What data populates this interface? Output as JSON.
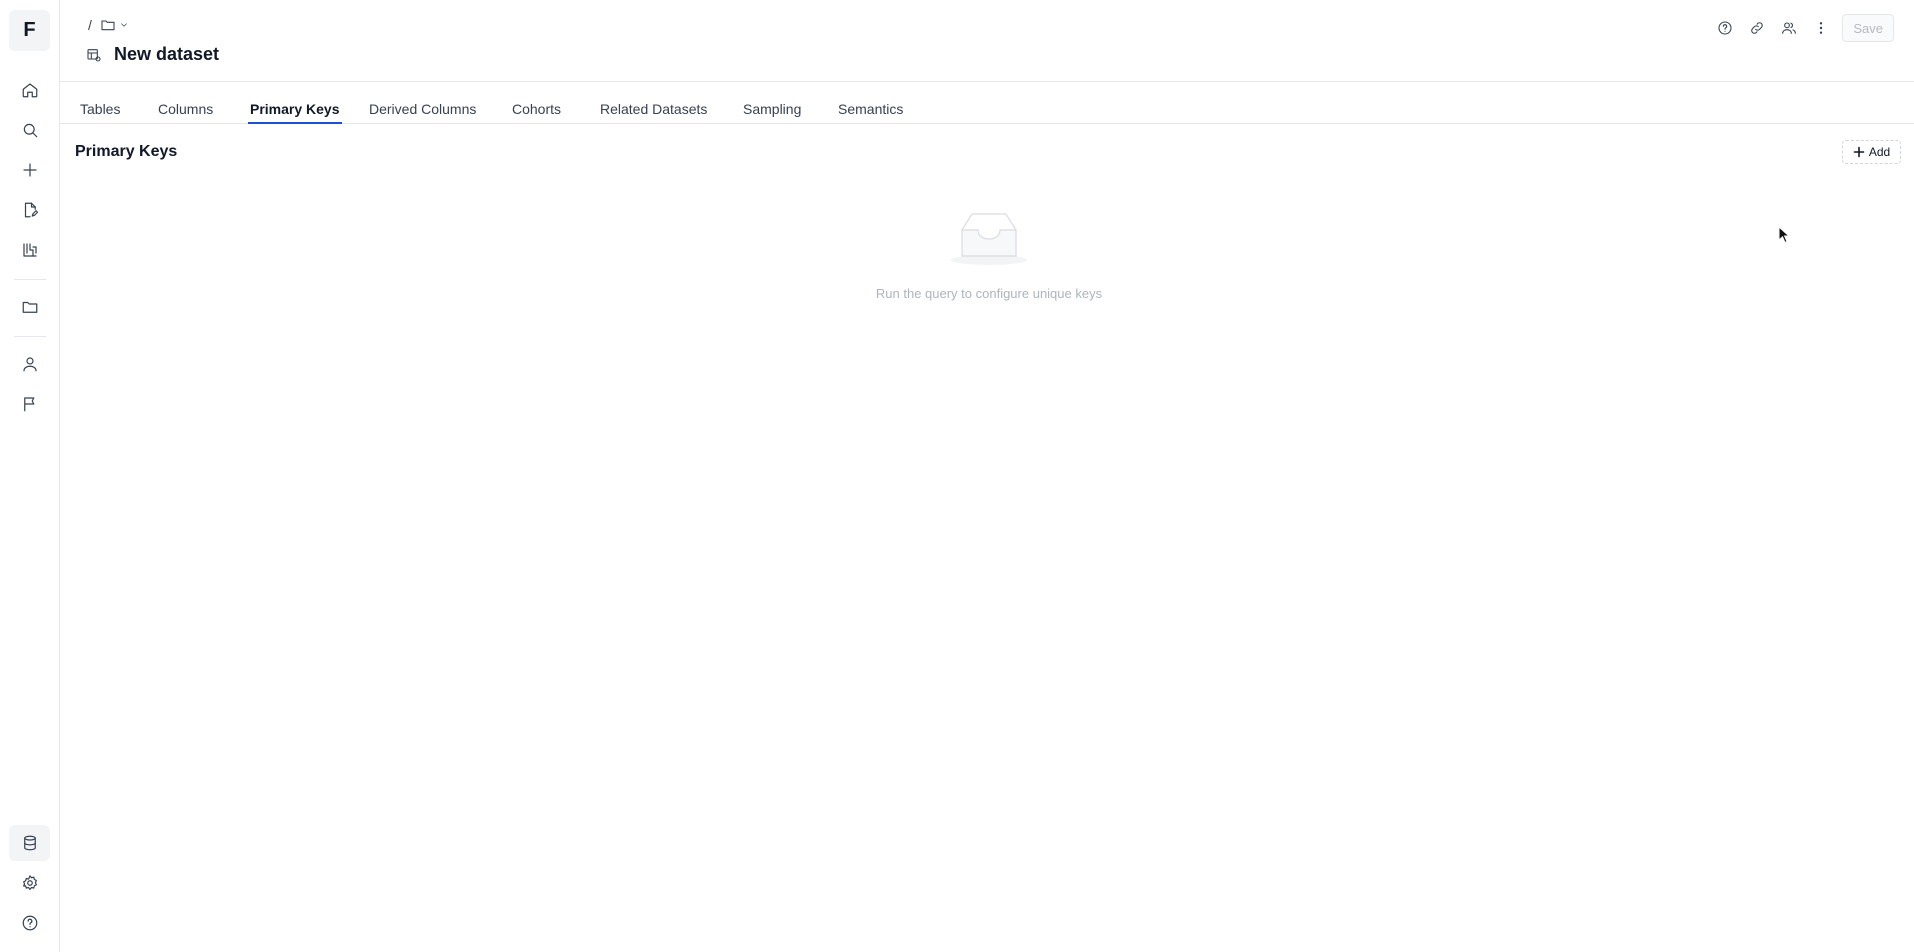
{
  "app": {
    "logo_letter": "F"
  },
  "sidebar": {
    "items": [
      {
        "name": "home",
        "icon": "home-icon"
      },
      {
        "name": "search",
        "icon": "search-icon"
      },
      {
        "name": "create",
        "icon": "plus-icon"
      },
      {
        "name": "edit-docs",
        "icon": "file-edit-icon"
      },
      {
        "name": "experiments",
        "icon": "flask-icon"
      },
      {
        "name": "folders",
        "icon": "folder-icon"
      },
      {
        "name": "users",
        "icon": "user-icon"
      },
      {
        "name": "flags",
        "icon": "flag-icon"
      },
      {
        "name": "datasets",
        "icon": "database-icon",
        "active": true
      },
      {
        "name": "settings",
        "icon": "gear-icon"
      },
      {
        "name": "help",
        "icon": "help-circle-icon"
      }
    ]
  },
  "header": {
    "breadcrumb_separator": "/",
    "title": "New dataset",
    "save_label": "Save"
  },
  "tabs": [
    {
      "label": "Tables"
    },
    {
      "label": "Columns"
    },
    {
      "label": "Primary Keys",
      "active": true
    },
    {
      "label": "Derived Columns"
    },
    {
      "label": "Cohorts"
    },
    {
      "label": "Related Datasets"
    },
    {
      "label": "Sampling"
    },
    {
      "label": "Semantics"
    }
  ],
  "section": {
    "title": "Primary Keys",
    "add_label": "Add",
    "empty_message": "Run the query to configure unique keys"
  },
  "colors": {
    "accent": "#1d4ed8",
    "border": "#e5e7eb",
    "muted_text": "#aeb4bd"
  }
}
